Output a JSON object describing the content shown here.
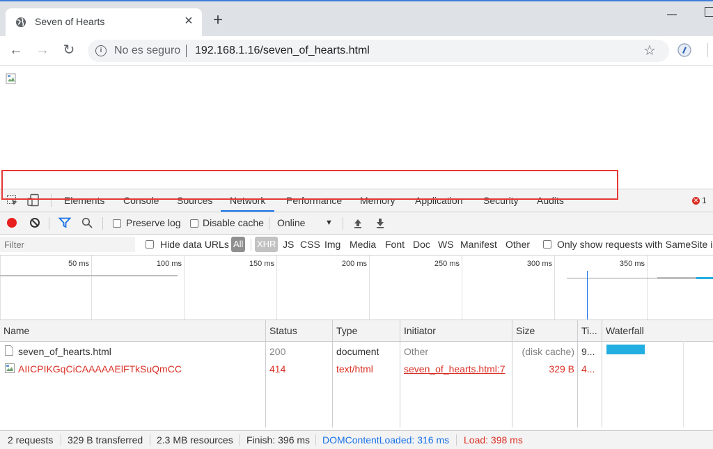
{
  "browser": {
    "tab_title": "Seven of Hearts",
    "tab_close": "×",
    "new_tab": "+",
    "nav": {
      "back": "←",
      "forward": "→",
      "reload": "↻"
    },
    "security_text": "No es seguro",
    "url": "192.168.1.16/seven_of_hearts.html",
    "star": "☆"
  },
  "devtools": {
    "tabs": [
      "Elements",
      "Console",
      "Sources",
      "Network",
      "Performance",
      "Memory",
      "Application",
      "Security",
      "Audits"
    ],
    "active_tab": "Network",
    "error_count": "1",
    "controls": {
      "preserve_log": "Preserve log",
      "disable_cache": "Disable cache",
      "throttling": "Online"
    },
    "filter": {
      "placeholder": "Filter",
      "hide_data_urls": "Hide data URLs",
      "types": [
        "All",
        "XHR",
        "JS",
        "CSS",
        "Img",
        "Media",
        "Font",
        "Doc",
        "WS",
        "Manifest",
        "Other"
      ],
      "samesite": "Only show requests with SameSite is"
    },
    "timeline": {
      "ticks": [
        "50 ms",
        "100 ms",
        "150 ms",
        "200 ms",
        "250 ms",
        "300 ms",
        "350 ms"
      ]
    },
    "table": {
      "columns": [
        "Name",
        "Status",
        "Type",
        "Initiator",
        "Size",
        "Ti...",
        "Waterfall"
      ],
      "rows": [
        {
          "name": "seven_of_hearts.html",
          "status": "200",
          "type": "document",
          "initiator": "Other",
          "size": "(disk cache)",
          "time": "9..."
        },
        {
          "name": "AIICPIKGqCiCAAAAAElFTkSuQmCC",
          "status": "414",
          "type": "text/html",
          "initiator": "seven_of_hearts.html:7",
          "size": "329 B",
          "time": "4..."
        }
      ]
    },
    "status": {
      "requests": "2 requests",
      "transferred": "329 B transferred",
      "resources": "2.3 MB resources",
      "finish": "Finish: 396 ms",
      "dom_loaded": "DOMContentLoaded: 316 ms",
      "load": "Load: 398 ms"
    },
    "colors": {
      "accent": "#1a73e8",
      "error": "#d93025",
      "dom_loaded": "#1a73e8",
      "load": "#d93025"
    }
  }
}
